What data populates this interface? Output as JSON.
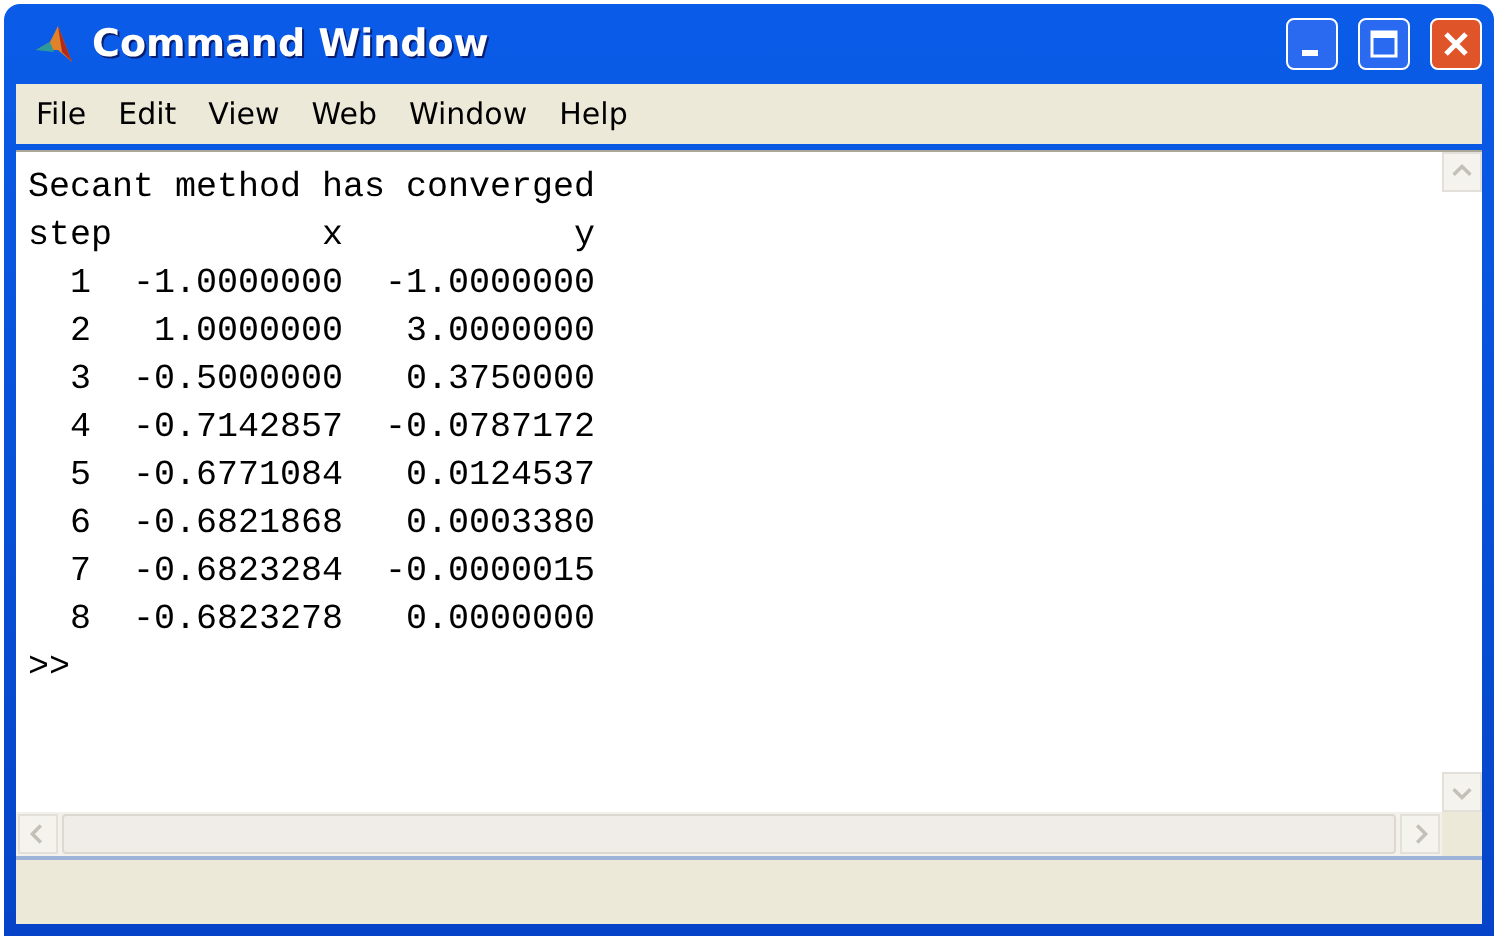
{
  "window": {
    "title": "Command Window"
  },
  "menu": [
    {
      "label": "File"
    },
    {
      "label": "Edit"
    },
    {
      "label": "View"
    },
    {
      "label": "Web"
    },
    {
      "label": "Window"
    },
    {
      "label": "Help"
    }
  ],
  "console": {
    "message": "Secant method has converged",
    "columns": [
      "step",
      "x",
      "y"
    ],
    "rows": [
      [
        "1",
        "-1.0000000",
        "-1.0000000"
      ],
      [
        "2",
        "1.0000000",
        "3.0000000"
      ],
      [
        "3",
        "-0.5000000",
        "0.3750000"
      ],
      [
        "4",
        "-0.7142857",
        "-0.0787172"
      ],
      [
        "5",
        "-0.6771084",
        "0.0124537"
      ],
      [
        "6",
        "-0.6821868",
        "0.0003380"
      ],
      [
        "7",
        "-0.6823284",
        "-0.0000015"
      ],
      [
        "8",
        "-0.6823278",
        "0.0000000"
      ]
    ],
    "prompt": ">>"
  }
}
